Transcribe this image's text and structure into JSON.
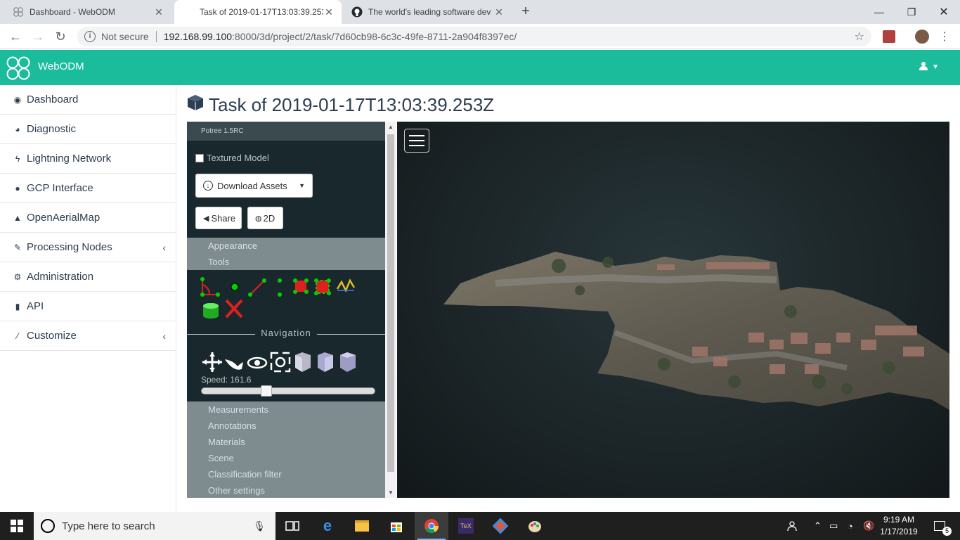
{
  "browser": {
    "tabs": [
      {
        "title": "Dashboard - WebODM",
        "active": false
      },
      {
        "title": "Task of 2019-01-17T13:03:39.253",
        "active": true
      },
      {
        "title": "The world's leading software dev",
        "active": false
      }
    ],
    "address": {
      "security_label": "Not secure",
      "host": "192.168.99.100",
      "path": ":8000/3d/project/2/task/7d60cb98-6c3c-49fe-8711-2a904f8397ec/"
    }
  },
  "app": {
    "name": "WebODM",
    "brand_color": "#1abc9c"
  },
  "sidebar": {
    "items": [
      {
        "label": "Dashboard",
        "icon": "dashboard-icon"
      },
      {
        "label": "Diagnostic",
        "icon": "pie-chart-icon"
      },
      {
        "label": "Lightning Network",
        "icon": "bolt-icon"
      },
      {
        "label": "GCP Interface",
        "icon": "map-marker-icon"
      },
      {
        "label": "OpenAerialMap",
        "icon": "rocket-icon"
      },
      {
        "label": "Processing Nodes",
        "icon": "wrench-icon",
        "expandable": true
      },
      {
        "label": "Administration",
        "icon": "gears-icon"
      },
      {
        "label": "API",
        "icon": "book-icon"
      },
      {
        "label": "Customize",
        "icon": "magic-icon",
        "expandable": true
      }
    ]
  },
  "page": {
    "title": "Task of 2019-01-17T13:03:39.253Z"
  },
  "potree": {
    "version": "Potree 1.5RC",
    "textured_model_label": "Textured Model",
    "download_label": "Download Assets",
    "share_label": "Share",
    "view_2d_label": "2D",
    "appearance_label": "Appearance",
    "tools_label": "Tools",
    "navigation_label": "Navigation",
    "speed_label": "Speed: 161.6",
    "speed_fraction": 0.36,
    "panels": [
      "Measurements",
      "Annotations",
      "Materials",
      "Scene",
      "Classification filter",
      "Other settings"
    ]
  },
  "taskbar": {
    "search_placeholder": "Type here to search",
    "time": "9:19 AM",
    "date": "1/17/2019",
    "notification_count": "5"
  }
}
